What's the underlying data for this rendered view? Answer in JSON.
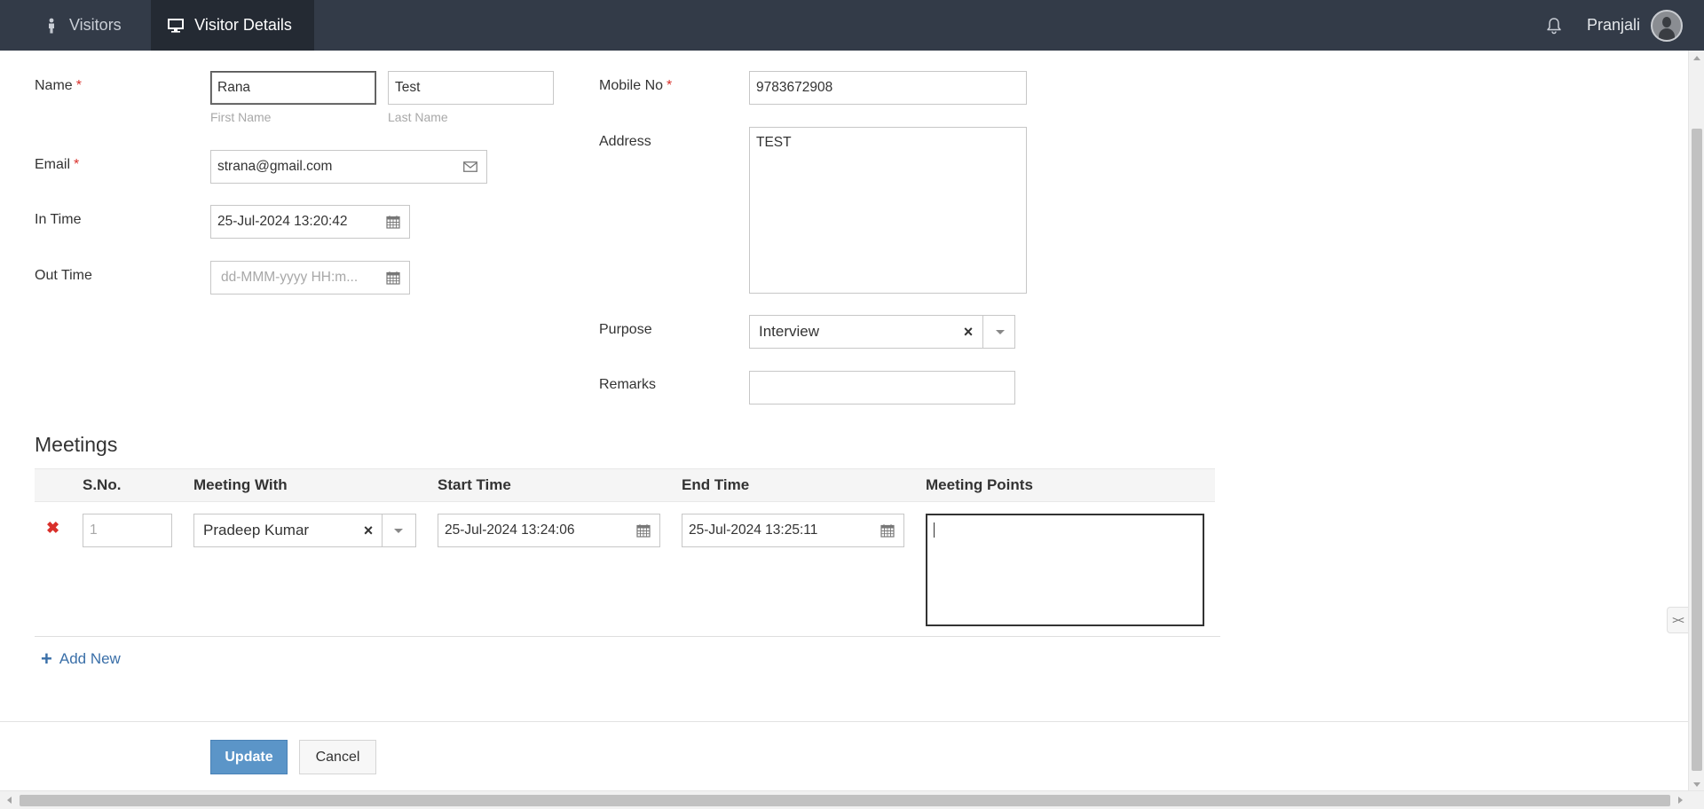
{
  "nav": {
    "tabs": [
      {
        "label": "Visitors",
        "icon": "person-icon"
      },
      {
        "label": "Visitor Details",
        "icon": "monitor-icon"
      }
    ],
    "user_name": "Pranjali"
  },
  "form": {
    "name": {
      "label": "Name",
      "required_mark": "*",
      "first": "Rana",
      "last": "Test",
      "first_hint": "First Name",
      "last_hint": "Last Name"
    },
    "email": {
      "label": "Email",
      "required_mark": "*",
      "value": "strana@gmail.com"
    },
    "in_time": {
      "label": "In Time",
      "value": "25-Jul-2024 13:20:42"
    },
    "out_time": {
      "label": "Out Time",
      "placeholder": "dd-MMM-yyyy HH:m..."
    },
    "mobile": {
      "label": "Mobile No",
      "required_mark": "*",
      "value": "9783672908"
    },
    "address": {
      "label": "Address",
      "value": "TEST"
    },
    "purpose": {
      "label": "Purpose",
      "value": "Interview"
    },
    "remarks": {
      "label": "Remarks",
      "value": ""
    }
  },
  "meetings": {
    "title": "Meetings",
    "columns": [
      "S.No.",
      "Meeting With",
      "Start Time",
      "End Time",
      "Meeting Points"
    ],
    "rows": [
      {
        "sno": "1",
        "meeting_with": "Pradeep Kumar",
        "start": "25-Jul-2024 13:24:06",
        "end": "25-Jul-2024 13:25:11",
        "points": ""
      }
    ],
    "add_new": "Add New"
  },
  "actions": {
    "update": "Update",
    "cancel": "Cancel"
  },
  "colors": {
    "topbar": "#333b48",
    "active_tab": "#242a33",
    "primary_button": "#5b95c8",
    "required": "#d9302b",
    "link": "#3a6fa8"
  }
}
